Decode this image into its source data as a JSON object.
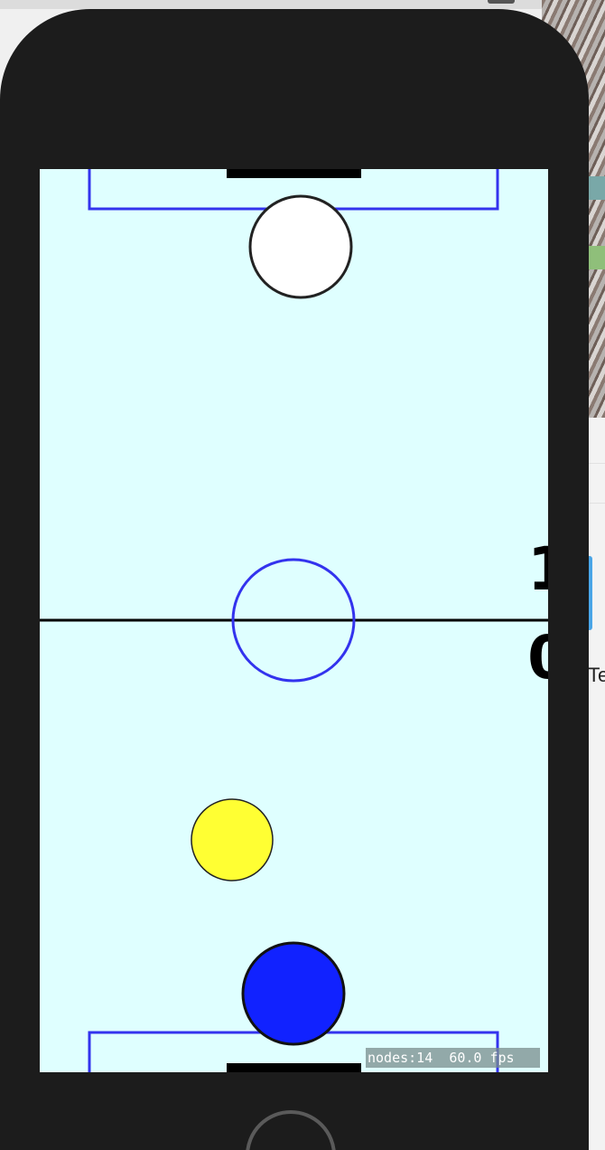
{
  "game": {
    "score_top": "1",
    "score_bottom": "0",
    "debug_nodes": "nodes:14",
    "debug_fps": "60.0 fps"
  },
  "background": {
    "partial_text": "Te"
  },
  "colors": {
    "rink": "#dfffff",
    "rink_lines": "#3333ff",
    "center_line": "#000000",
    "goal": "#000000",
    "puck": "#ffff33",
    "player_paddle": "#1122ff",
    "opponent_paddle": "#ffffff",
    "phone_body": "#1c1c1c"
  }
}
